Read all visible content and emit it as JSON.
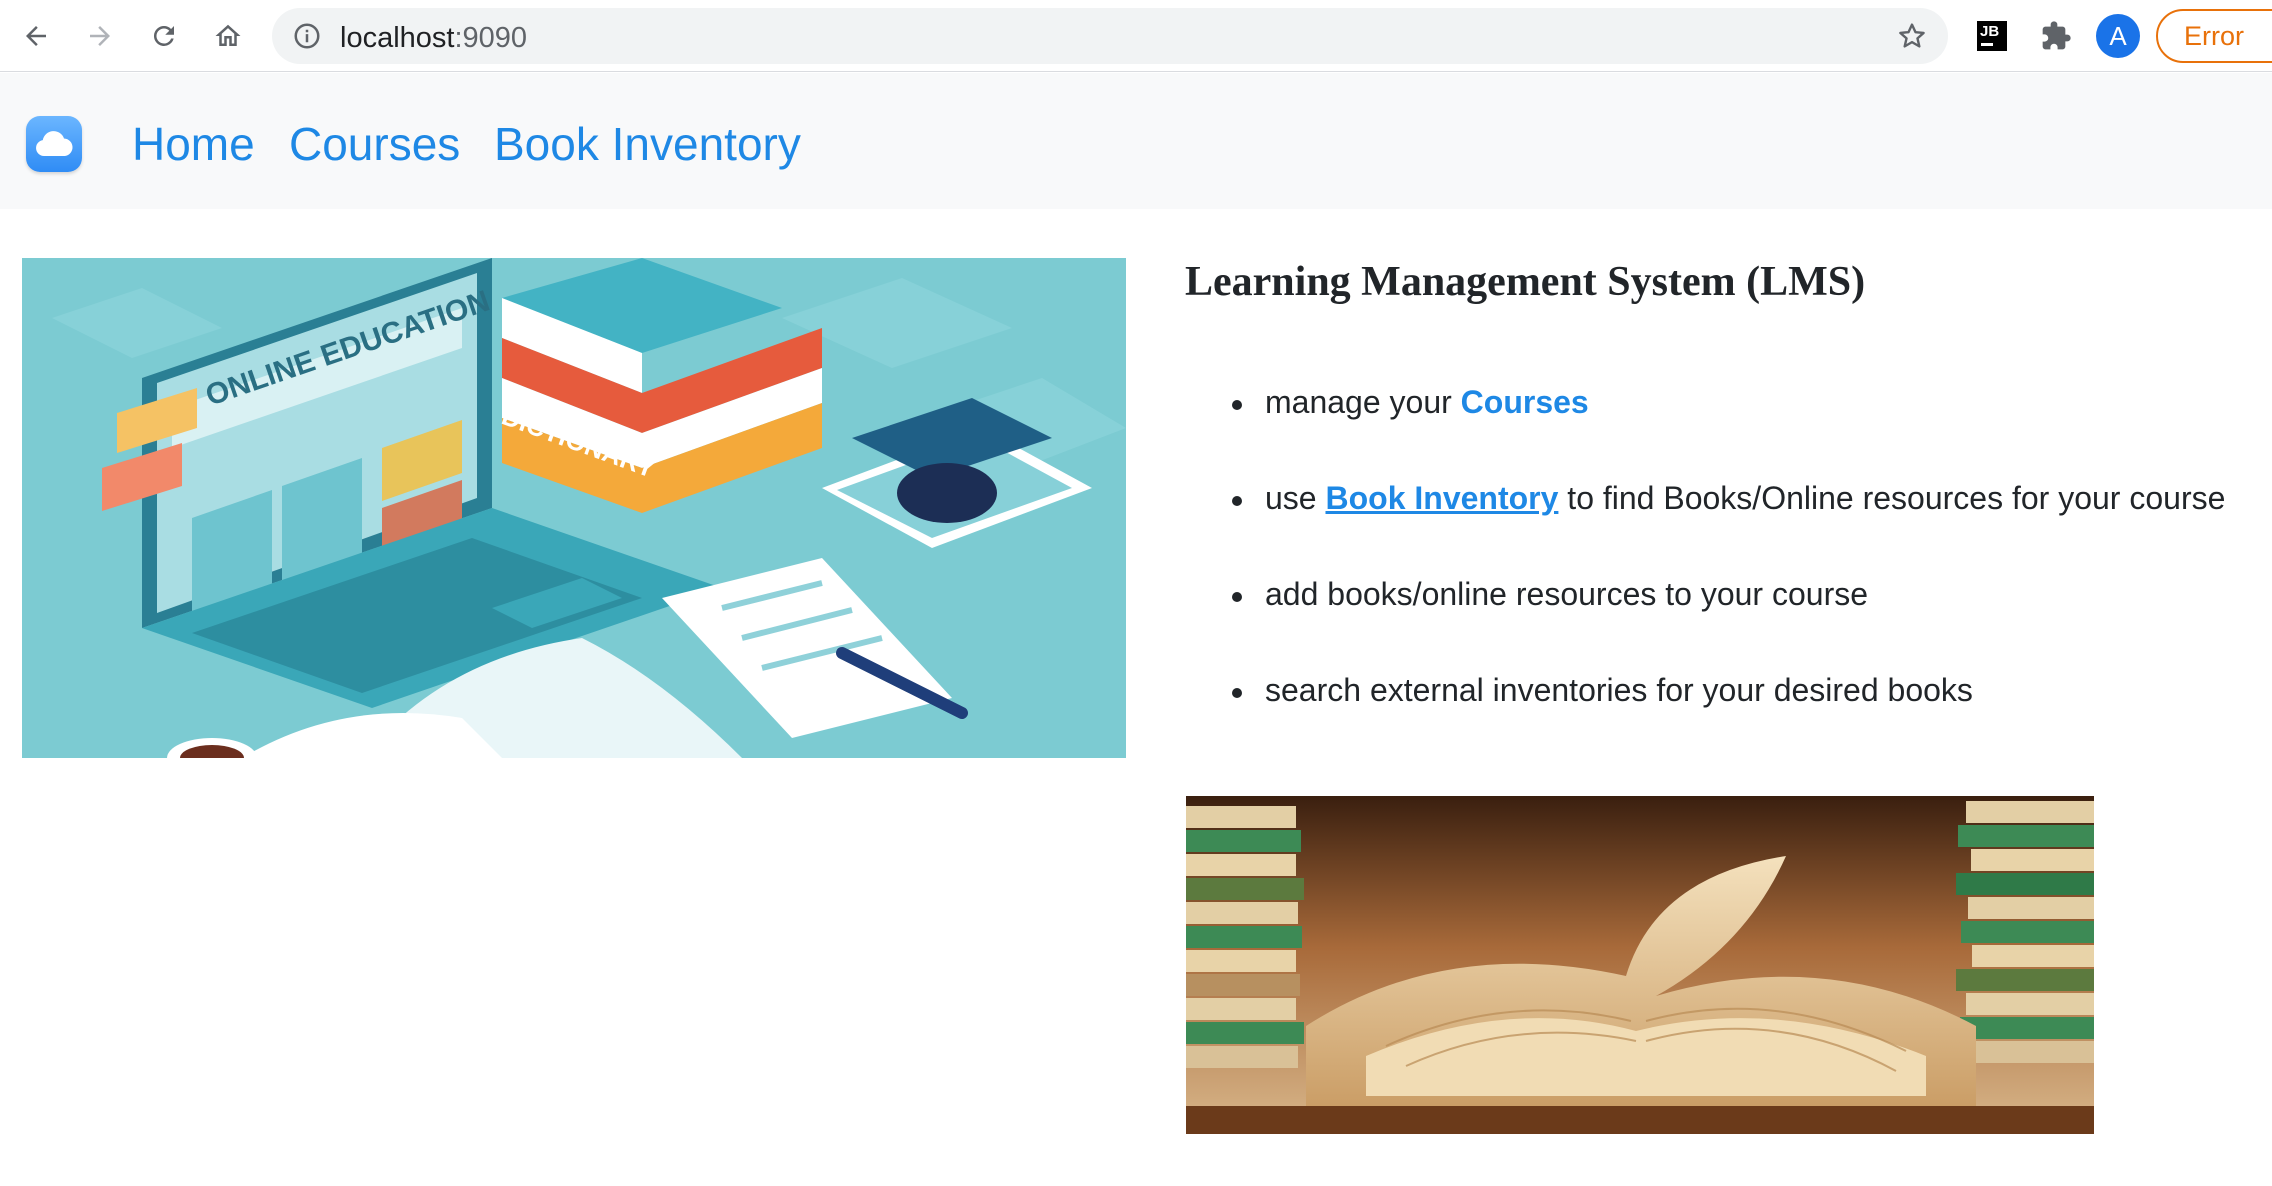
{
  "browser": {
    "url_host": "localhost",
    "url_port": ":9090",
    "profile_initial": "A",
    "error_label": "Error",
    "extension_jb": "JB"
  },
  "navbar": {
    "links": [
      {
        "label": "Home"
      },
      {
        "label": "Courses"
      },
      {
        "label": "Book Inventory"
      }
    ]
  },
  "main": {
    "heading": "Learning Management System (LMS)",
    "features": [
      {
        "pre": "manage your ",
        "link": "Courses",
        "post": ""
      },
      {
        "pre": "use ",
        "link": "Book Inventory",
        "post": " to find Books/Online resources for your course"
      },
      {
        "pre": "add books/online resources to your course",
        "link": "",
        "post": ""
      },
      {
        "pre": "search external inventories for your desired books",
        "link": "",
        "post": ""
      }
    ],
    "hero_illustration_text": {
      "laptop_banner": "ONLINE EDUCATION",
      "book_spine": "DICTIONARY"
    }
  },
  "colors": {
    "link": "#1e88e5",
    "navbar_bg": "#f8f9fa",
    "error_orange": "#e8710a",
    "hero_bg": "#7ccbd2"
  }
}
